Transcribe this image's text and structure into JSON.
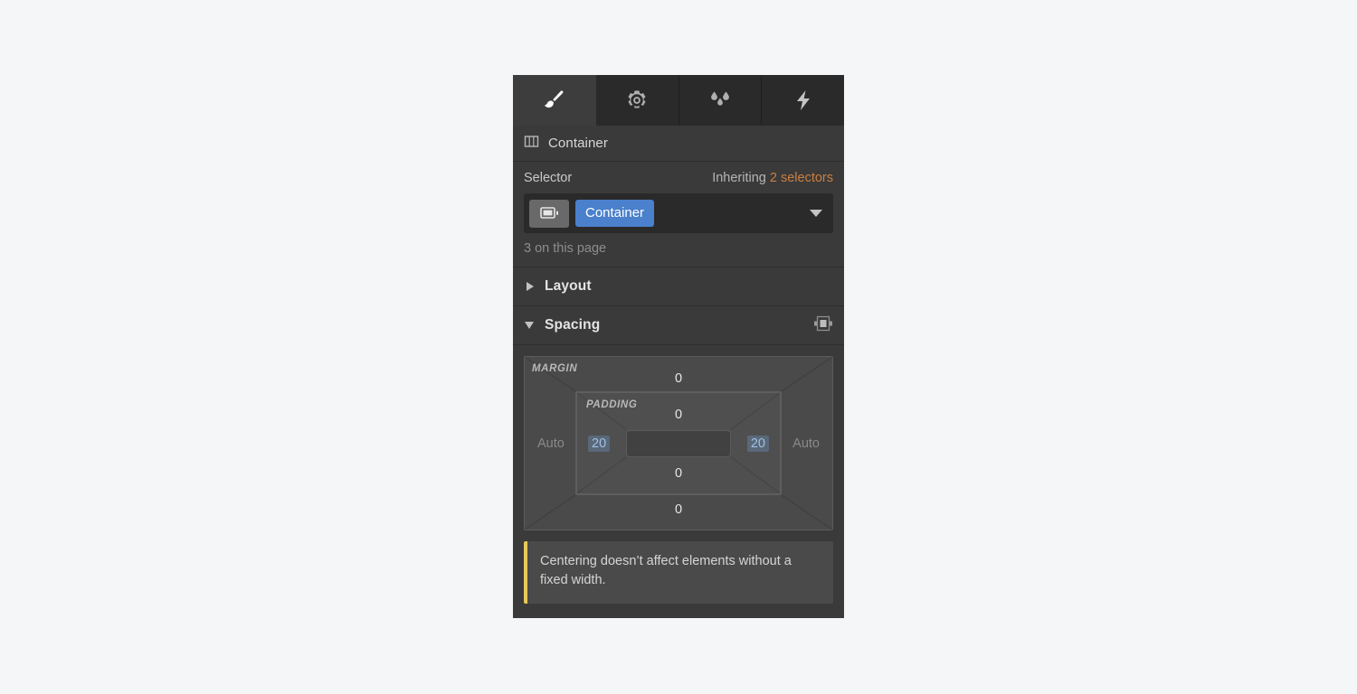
{
  "tabs": [
    {
      "name": "style",
      "icon": "paint-brush-icon",
      "active": true
    },
    {
      "name": "settings",
      "icon": "gear-icon",
      "active": false
    },
    {
      "name": "effects",
      "icon": "water-drops-icon",
      "active": false
    },
    {
      "name": "interactions",
      "icon": "lightning-bolt-icon",
      "active": false
    }
  ],
  "breadcrumb": {
    "icon": "container-icon",
    "label": "Container"
  },
  "selector": {
    "title": "Selector",
    "inheriting_prefix": "Inheriting",
    "inheriting_count": "2 selectors",
    "device_icon": "desktop-device-icon",
    "tag": "Container",
    "dropdown_icon": "chevron-down-icon",
    "count_note": "3 on this page"
  },
  "sections": {
    "layout": {
      "title": "Layout",
      "expanded": false,
      "toggle_icon": "triangle-right-icon"
    },
    "spacing": {
      "title": "Spacing",
      "expanded": true,
      "toggle_icon": "triangle-down-icon",
      "action_icon": "center-align-icon"
    }
  },
  "spacing_widget": {
    "margin_label": "MARGIN",
    "padding_label": "PADDING",
    "margin": {
      "top": "0",
      "right": "Auto",
      "bottom": "0",
      "left": "Auto"
    },
    "padding": {
      "top": "0",
      "right": "20",
      "bottom": "0",
      "left": "20"
    }
  },
  "notice": {
    "text": "Centering doesn’t affect elements without a fixed width."
  },
  "colors": {
    "panel_bg": "#3a3a3a",
    "tabbar_bg": "#2a2a2a",
    "active_tab_bg": "#3d3d3d",
    "accent_blue": "#4a80cc",
    "accent_orange": "#c97f42",
    "notice_border": "#e8c85a",
    "selected_value": "#9fc0e8"
  }
}
